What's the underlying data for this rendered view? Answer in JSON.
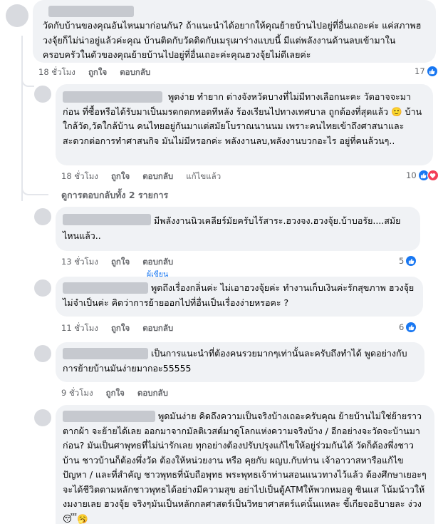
{
  "comments": [
    {
      "text": "วัดกับบ้านของคุณอันไหนมาก่อนกัน? ถ้าแนะนำได้อยากให้คุณย้ายบ้านไปอยู่ที่อื่นเถอะค่ะ แค่สภาพฮวงจุ้ยก็ไม่น่าอยู่แล้วค่ะคุณ บ้านติดกับวัดติดกับเมรุเผาร่างแบบนี้ มีแต่พลังงานด้านลบเข้ามาในครอบครัวในตัวของคุณย้ายบ้านไปอยู่ที่อื่นเถอะค่ะคุณฮวงจุ้ยไม่ดีเลยค่ะ",
      "time": "18 ชั่วโมง",
      "like": "ถูกใจ",
      "reply": "ตอบกลับ",
      "reactions": "17"
    },
    {
      "text": "พูดง่าย ทำยาก ต่างจังหวัดบางที่ไม่มีทางเลือกนะคะ วัดอาจจะมาก่อน ที่ซื้อหรือได้รับมาเป็นมรดกตกทอดทีหลัง ร้องเรียนไปทางเทศบาล ถูกต้องที่สุดแล้ว 🙂 บ้านใกล้วัด,วัดใกล้บ้าน คนไทยอยู่กันมาแต่สมัยโบราณนานนม เพราะคนไทยเข้าถึงศาสนาและสะดวกต่อการทำศาสนกิจ มันไม่มีหรอกค่ะ พลังงานลบ,พลังงานบวกอะไร อยู่ที่คนล้วนๆ..",
      "time": "18 ชั่วโมง",
      "like": "ถูกใจ",
      "reply": "ตอบกลับ",
      "edited": "แก้ไขแล้ว",
      "reactions": "10"
    },
    {
      "text": "มีพลังงานนิวเคลียร์มัยครับไร้สาระ.ฮวงจง.ฮวงจุ้ย.บ้าบอรัย....สมัยไหนแล้ว..",
      "time": "13 ชั่วโมง",
      "like": "ถูกใจ",
      "reply": "ตอบกลับ",
      "reactions": "5"
    },
    {
      "author_tag": "ผู้เขียน",
      "text": "พูดถึงเรื่องกลิ่นค่ะ ไม่เอาฮวงจุ้ยค่ะ ทำงานเก็บเงินค่ะรักสุขภาพ ฮวงจุ้ยไม่จำเป็นค่ะ คิดว่าการย้ายออกไปที่อื่นเป็นเรื่องง่ายหรอคะ ?",
      "time": "11 ชั่วโมง",
      "like": "ถูกใจ",
      "reply": "ตอบกลับ",
      "reactions": "6"
    },
    {
      "text": "เป็นการแนะนำที่ต้องคนรวยมากๆเท่านั้นละครับถึงทำได้ พูดอย่างกับการย้ายบ้านมันง่ายมากอะ55555",
      "time": "9 ชั่วโมง",
      "like": "ถูกใจ",
      "reply": "ตอบกลับ"
    },
    {
      "text": "พูดมันง่าย คิดถึงความเป็นจริงบ้างเถอะครับคุณ ย้ายบ้านไม่ใช่ย้ายราวตากผ้า จะย้ายได้เลย ออกมาจากมัลติเวสต์มาดูโลกแห่งความจริงบ้าง / อีกอย่างจะวัดจะบ้านมาก่อน? มันเป็นศาพุทธที่ไม่น่ารักเลย ทุกอย่างต้องปรับปรุงแก้ไขให้อยู่ร่วมกันได้ วัดก็ต้องพึ่งชาวบ้าน ชาวบ้านก็ต้องพึ่งวัด ต้องให้หน่วยงาน หรือ คุยกับ ผญบ.กับท่าน เจ้าอาวาสหารือแก้ไขปัญหา / และที่สำคัญ ชาวพุทธที่นับถือพุทธ พระพุทธเจ้าท่านสอนแนวทางไว้แล้ว ต้องศึกษาเยอะๆ จะได้ชีวิตตามหลักชาวพุทธได้อย่างมีความสุข อย่าไปเป็นตู้ATMให้พวกหมอดู ซินแส โน้มน้าวให้งมงายเลย ฮวงจุ้ย จริงๆมันเป็นหลักกลศาสตร์เป็นวิทยาศาสตร์แค่นั้นแหละ ขี้เกียจอธิบายละ ง่วง😴🥱"
    }
  ],
  "view_replies": "ดูการตอบกลับทั้ง 2 รายการ",
  "colors": {
    "like_blue": "#1877f2",
    "heart_red": "#f33e58",
    "bubble_gray": "#f0f2f5",
    "meta_gray": "#65676b"
  },
  "icons": [
    "like-icon",
    "heart-icon"
  ]
}
